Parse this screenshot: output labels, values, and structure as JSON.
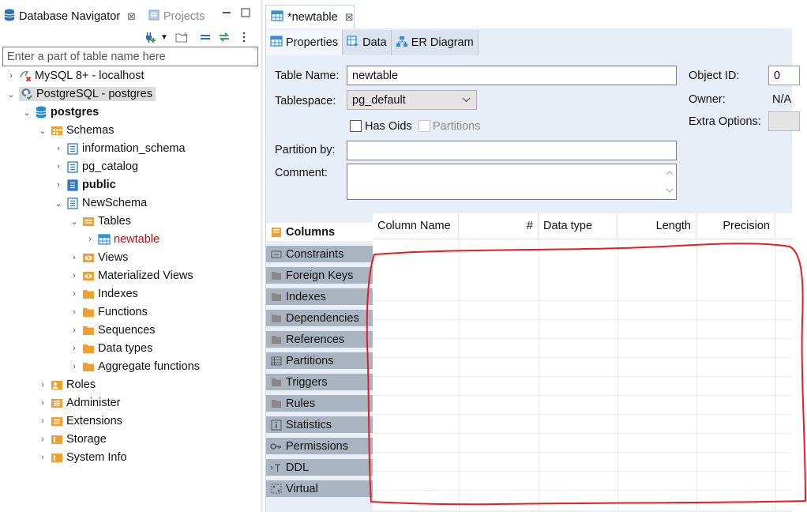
{
  "left_panel": {
    "tabs": [
      {
        "label": "Database Navigator",
        "close": "⊠"
      },
      {
        "label": "Projects"
      }
    ],
    "filter_placeholder": "Enter a part of table name here",
    "tree": [
      {
        "label": "MySQL 8+ - localhost",
        "icon": "mysql-connection-icon",
        "depth": 0,
        "expander": "›"
      },
      {
        "label": "PostgreSQL - postgres",
        "icon": "postgresql-connection-icon",
        "depth": 0,
        "expander": "⌄",
        "selected": true
      },
      {
        "label": "postgres",
        "icon": "database-icon",
        "depth": 1,
        "expander": "⌄",
        "bold": true
      },
      {
        "label": "Schemas",
        "icon": "schemas-folder-icon",
        "depth": 2,
        "expander": "⌄"
      },
      {
        "label": "information_schema",
        "icon": "schema-icon",
        "depth": 3,
        "expander": "›"
      },
      {
        "label": "pg_catalog",
        "icon": "schema-icon",
        "depth": 3,
        "expander": "›"
      },
      {
        "label": "public",
        "icon": "schema-icon",
        "depth": 3,
        "expander": "›",
        "bold": true
      },
      {
        "label": "NewSchema",
        "icon": "schema-icon",
        "depth": 3,
        "expander": "⌄"
      },
      {
        "label": "Tables",
        "icon": "tables-folder-icon",
        "depth": 4,
        "expander": "⌄"
      },
      {
        "label": "newtable",
        "icon": "table-icon",
        "depth": 5,
        "expander": "›",
        "red": true
      },
      {
        "label": "Views",
        "icon": "views-folder-icon",
        "depth": 4,
        "expander": "›"
      },
      {
        "label": "Materialized Views",
        "icon": "views-folder-icon",
        "depth": 4,
        "expander": "›"
      },
      {
        "label": "Indexes",
        "icon": "folder-icon",
        "depth": 4,
        "expander": "›"
      },
      {
        "label": "Functions",
        "icon": "folder-icon",
        "depth": 4,
        "expander": "›"
      },
      {
        "label": "Sequences",
        "icon": "folder-icon",
        "depth": 4,
        "expander": "›"
      },
      {
        "label": "Data types",
        "icon": "folder-icon",
        "depth": 4,
        "expander": "›"
      },
      {
        "label": "Aggregate functions",
        "icon": "folder-icon",
        "depth": 4,
        "expander": "›"
      },
      {
        "label": "Roles",
        "icon": "roles-icon",
        "depth": 2,
        "expander": "›"
      },
      {
        "label": "Administer",
        "icon": "administer-icon",
        "depth": 2,
        "expander": "›"
      },
      {
        "label": "Extensions",
        "icon": "extensions-icon",
        "depth": 2,
        "expander": "›"
      },
      {
        "label": "Storage",
        "icon": "storage-icon",
        "depth": 2,
        "expander": "›"
      },
      {
        "label": "System Info",
        "icon": "system-info-icon",
        "depth": 2,
        "expander": "›"
      }
    ]
  },
  "editor": {
    "tab": {
      "label": "*newtable",
      "close": "⊠"
    },
    "subtabs": [
      {
        "label": "Properties",
        "icon": "properties-icon",
        "active": true
      },
      {
        "label": "Data",
        "icon": "data-icon"
      },
      {
        "label": "ER Diagram",
        "icon": "er-diagram-icon"
      }
    ],
    "form": {
      "table_name_label": "Table Name:",
      "table_name_value": "newtable",
      "tablespace_label": "Tablespace:",
      "tablespace_value": "pg_default",
      "has_oids_label": "Has Oids",
      "partitions_label": "Partitions",
      "partition_by_label": "Partition by:",
      "partition_by_value": "",
      "comment_label": "Comment:",
      "comment_value": "",
      "object_id_label": "Object ID:",
      "object_id_value": "0",
      "owner_label": "Owner:",
      "owner_value": "N/A",
      "extra_options_label": "Extra Options:"
    },
    "side_tabs": [
      {
        "label": "Columns",
        "icon": "columns-icon",
        "active": true
      },
      {
        "label": "Constraints",
        "icon": "constraints-icon"
      },
      {
        "label": "Foreign Keys",
        "icon": "folder-icon"
      },
      {
        "label": "Indexes",
        "icon": "folder-icon"
      },
      {
        "label": "Dependencies",
        "icon": "folder-icon"
      },
      {
        "label": "References",
        "icon": "folder-icon"
      },
      {
        "label": "Partitions",
        "icon": "partitions-icon"
      },
      {
        "label": "Triggers",
        "icon": "folder-icon"
      },
      {
        "label": "Rules",
        "icon": "folder-icon"
      },
      {
        "label": "Statistics",
        "icon": "statistics-icon"
      },
      {
        "label": "Permissions",
        "icon": "key-icon"
      },
      {
        "label": "DDL",
        "icon": "ddl-icon"
      },
      {
        "label": "Virtual",
        "icon": "virtual-icon"
      }
    ],
    "grid_headers": [
      "Column Name",
      "#",
      "Data type",
      "Length",
      "Precision"
    ]
  },
  "colors": {
    "editor_bg": "#e8eef7",
    "side_tab_bg": "#aab4c1",
    "folder_orange": "#f0a030",
    "postgres_blue": "#1e88d9",
    "annotation_red": "#e02020",
    "selected_node_text": "#a11616"
  }
}
